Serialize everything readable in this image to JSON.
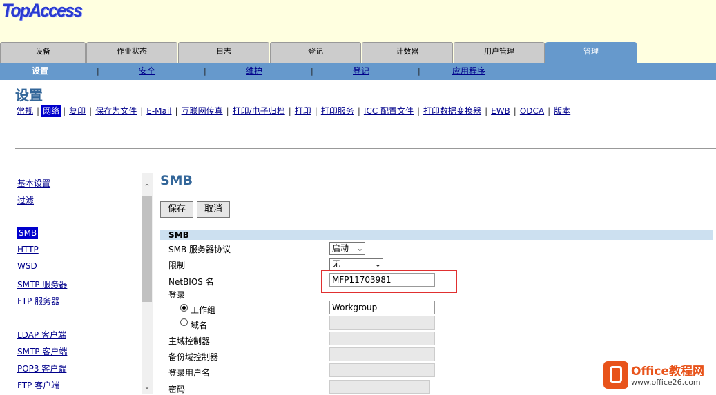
{
  "header": {
    "logo": "TopAccess"
  },
  "tabs": [
    {
      "label": "设备"
    },
    {
      "label": "作业状态"
    },
    {
      "label": "日志"
    },
    {
      "label": "登记"
    },
    {
      "label": "计数器"
    },
    {
      "label": "用户管理"
    },
    {
      "label": "管理",
      "active": true
    }
  ],
  "subnav": [
    {
      "label": "设置",
      "active": true
    },
    {
      "label": "安全"
    },
    {
      "label": "维护"
    },
    {
      "label": "登记"
    },
    {
      "label": "应用程序"
    }
  ],
  "page_title": "设置",
  "net_links": [
    "常规",
    "网络",
    "复印",
    "保存为文件",
    "E-Mail",
    "互联网传真",
    "打印/电子归档",
    "打印",
    "打印服务",
    "ICC 配置文件",
    "打印数据变换器",
    "EWB",
    "ODCA",
    "版本"
  ],
  "sidebar": [
    "基本设置",
    "过滤",
    "SMB",
    "HTTP",
    "WSD",
    "SMTP 服务器",
    "FTP 服务器",
    "LDAP 客户端",
    "SMTP 客户端",
    "POP3 客户端",
    "FTP 客户端"
  ],
  "smb": {
    "title": "SMB",
    "save_label": "保存",
    "cancel_label": "取消",
    "section": "SMB",
    "protocol_label": "SMB 服务器协议",
    "protocol_value": "启动",
    "restrict_label": "限制",
    "restrict_value": "无",
    "netbios_label": "NetBIOS 名",
    "netbios_value": "MFP11703981",
    "logon_label": "登录",
    "workgroup_label": "工作组",
    "workgroup_value": "Workgroup",
    "domain_label": "域名",
    "primary_dc_label": "主域控制器",
    "backup_dc_label": "备份域控制器",
    "logon_user_label": "登录用户名",
    "password_label": "密码"
  },
  "watermark": {
    "brand": "Office教程网",
    "url": "www.office26.com"
  }
}
